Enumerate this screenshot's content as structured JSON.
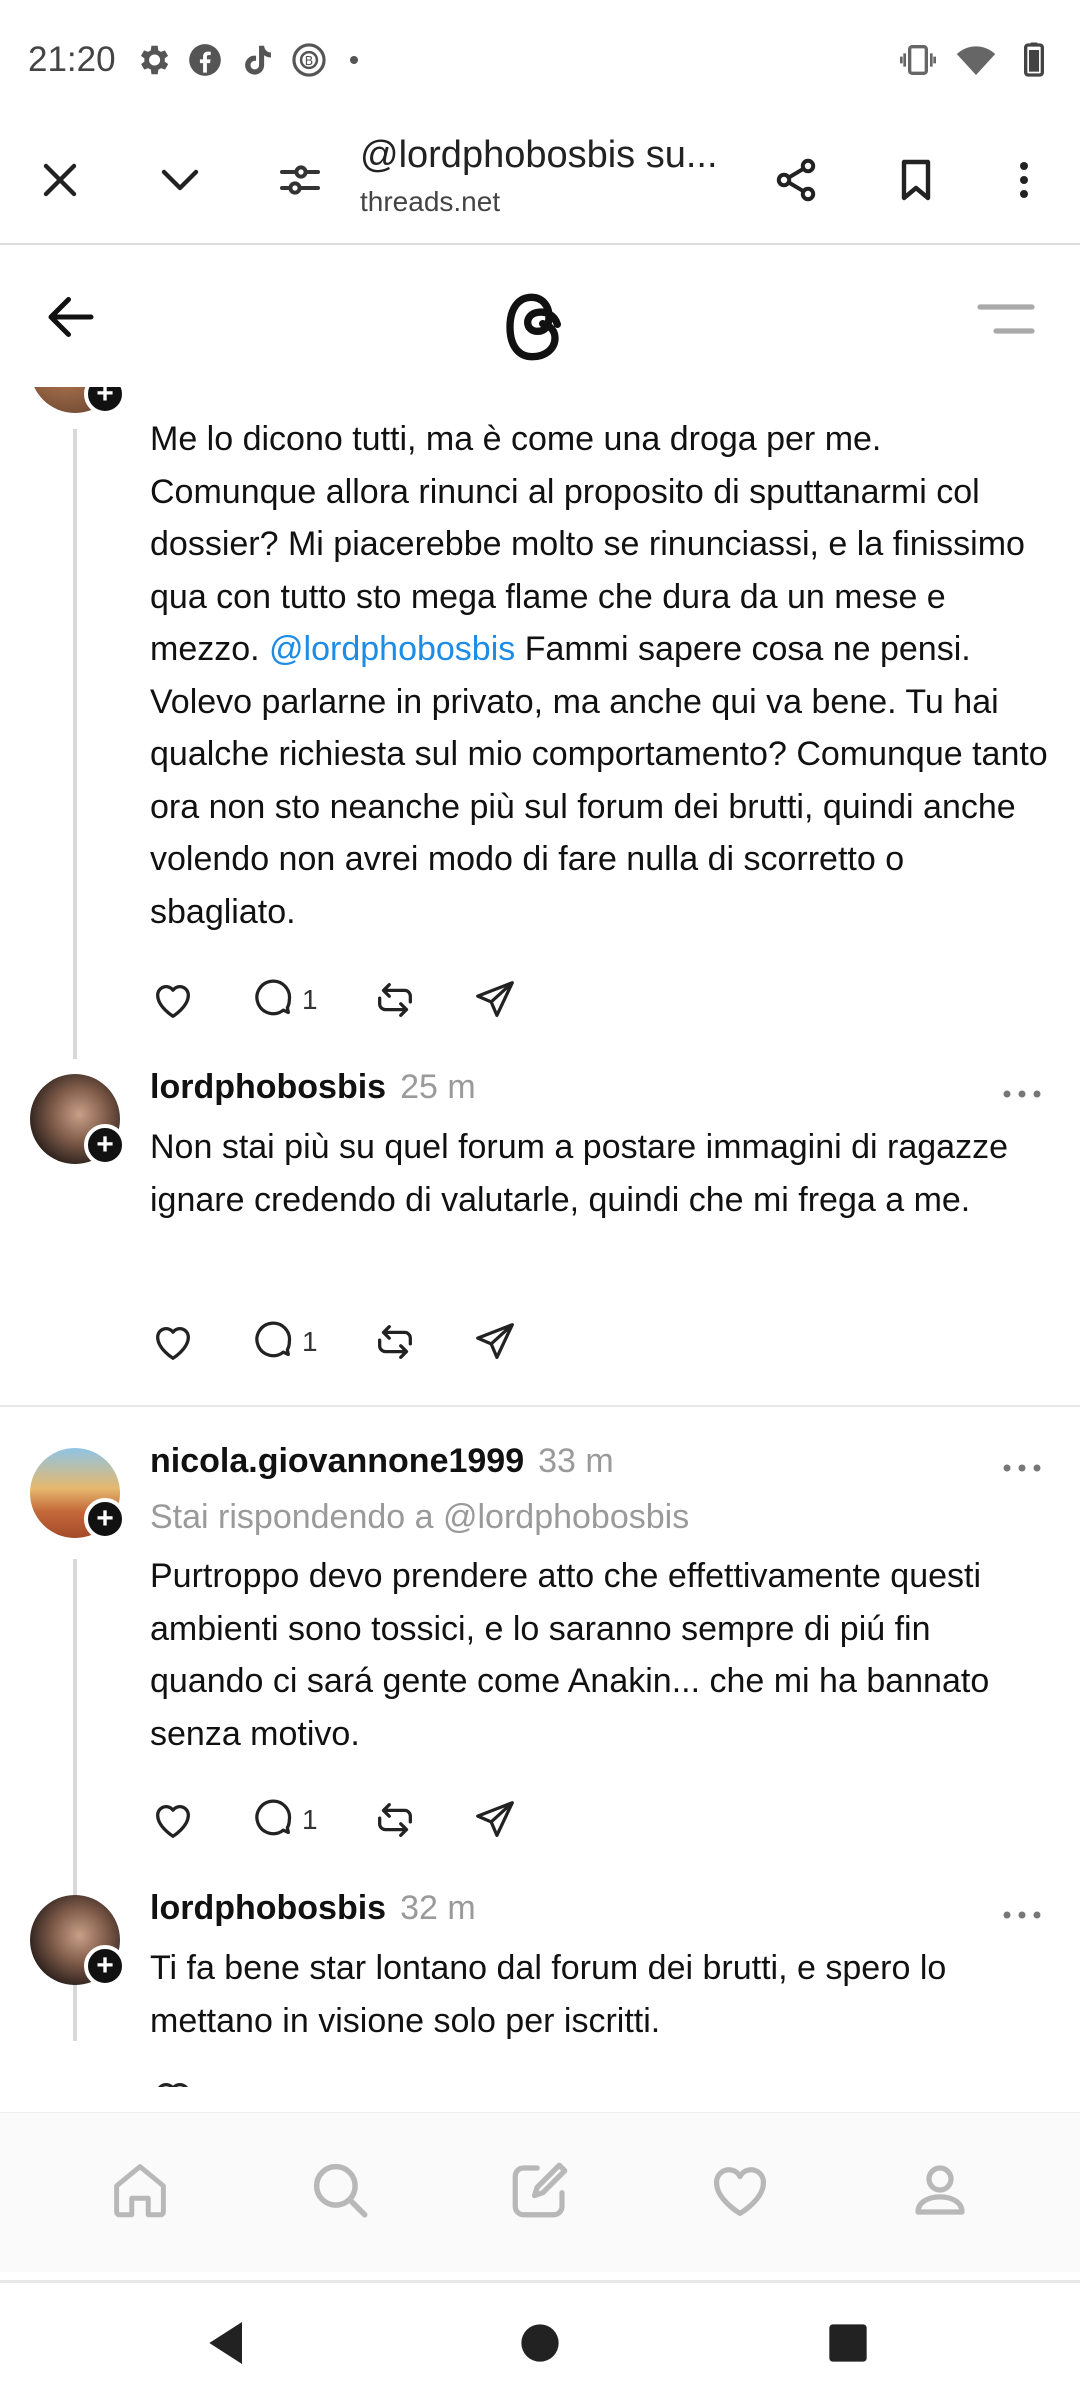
{
  "status_bar": {
    "time": "21:20",
    "icons": [
      "gear-icon",
      "facebook-icon",
      "tiktok-icon",
      "bitcoin-icon",
      "dot-icon"
    ],
    "right_icons": [
      "vibrate-icon",
      "wifi-icon",
      "battery-icon"
    ]
  },
  "browser": {
    "title": "@lordphobosbis su...",
    "url": "threads.net",
    "buttons": [
      "close-icon",
      "chevron-down-icon",
      "tune-icon",
      "share-icon",
      "bookmark-icon",
      "more-vert-icon"
    ]
  },
  "posts": [
    {
      "text_before": "Me lo dicono tutti, ma è come una droga per me. Comunque allora rinunci al proposito di sputtanarmi col dossier? Mi piacerebbe molto se rinunciassi, e la finissimo qua con tutto sto mega flame che dura da un mese e mezzo. ",
      "mention": "@lordphobosbis",
      "text_after": " Fammi sapere cosa ne pensi. Volevo parlarne in privato, ma anche qui va bene. Tu hai qualche richiesta sul mio comportamento? Comunque tanto ora non sto neanche più sul forum dei brutti, quindi anche volendo non avrei modo di fare nulla di scorretto o sbagliato.",
      "replies": "1"
    },
    {
      "username": "lordphobosbis",
      "time": "25 m",
      "text": "Non stai più su quel forum a postare immagini di ragazze ignare credendo di valutarle, quindi che mi frega a me.",
      "replies": "1"
    },
    {
      "username": "nicola.giovannone1999",
      "time": "33 m",
      "reply_to": "Stai rispondendo a @lordphobosbis",
      "text": "Purtroppo devo prendere atto che effettivamente questi ambienti sono tossici, e lo saranno sempre di piú fin quando ci sará gente come Anakin... che mi ha bannato senza motivo.",
      "replies": "1"
    },
    {
      "username": "lordphobosbis",
      "time": "32 m",
      "text": "Ti fa bene star lontano dal forum dei brutti, e spero lo mettano in visione solo per iscritti."
    }
  ],
  "colors": {
    "mention": "#1d8ce6",
    "muted": "#9a9a9a"
  }
}
